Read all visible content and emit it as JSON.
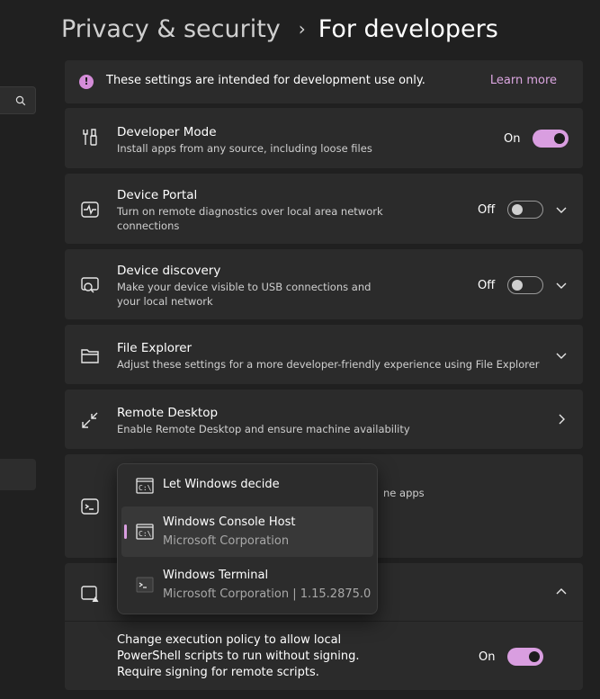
{
  "breadcrumb": {
    "parent": "Privacy & security",
    "separator": "›",
    "current": "For developers"
  },
  "info": {
    "text": "These settings are intended for development use only.",
    "link": "Learn more",
    "icon": "info-icon"
  },
  "settings": {
    "developer_mode": {
      "title": "Developer Mode",
      "desc": "Install apps from any source, including loose files",
      "state": "On",
      "icon": "developer-tools-icon"
    },
    "device_portal": {
      "title": "Device Portal",
      "desc": "Turn on remote diagnostics over local area network connections",
      "state": "Off",
      "icon": "pulse-monitor-icon"
    },
    "device_discovery": {
      "title": "Device discovery",
      "desc": "Make your device visible to USB connections and your local network",
      "state": "Off",
      "icon": "device-discovery-icon"
    },
    "file_explorer": {
      "title": "File Explorer",
      "desc": "Adjust these settings for a more developer-friendly experience using File Explorer",
      "icon": "folder-icon"
    },
    "remote_desktop": {
      "title": "Remote Desktop",
      "desc": "Enable Remote Desktop and ensure machine availability",
      "icon": "remote-desktop-icon"
    },
    "terminal": {
      "desc_fragment": "ne apps",
      "icon": "terminal-icon"
    },
    "powershell": {
      "desc": "Change execution policy to allow local PowerShell scripts to run without signing. Require signing for remote scripts.",
      "state": "On",
      "icon": "powershell-icon"
    }
  },
  "flyout": {
    "items": [
      {
        "name": "Let Windows decide",
        "sub": ""
      },
      {
        "name": "Windows Console Host",
        "sub": "Microsoft Corporation",
        "selected": true
      },
      {
        "name": "Windows Terminal",
        "sub": "Microsoft Corporation  |  1.15.2875.0"
      }
    ]
  },
  "colors": {
    "accent": "#d99ee0",
    "background": "#202020",
    "card": "#2b2b2b"
  }
}
